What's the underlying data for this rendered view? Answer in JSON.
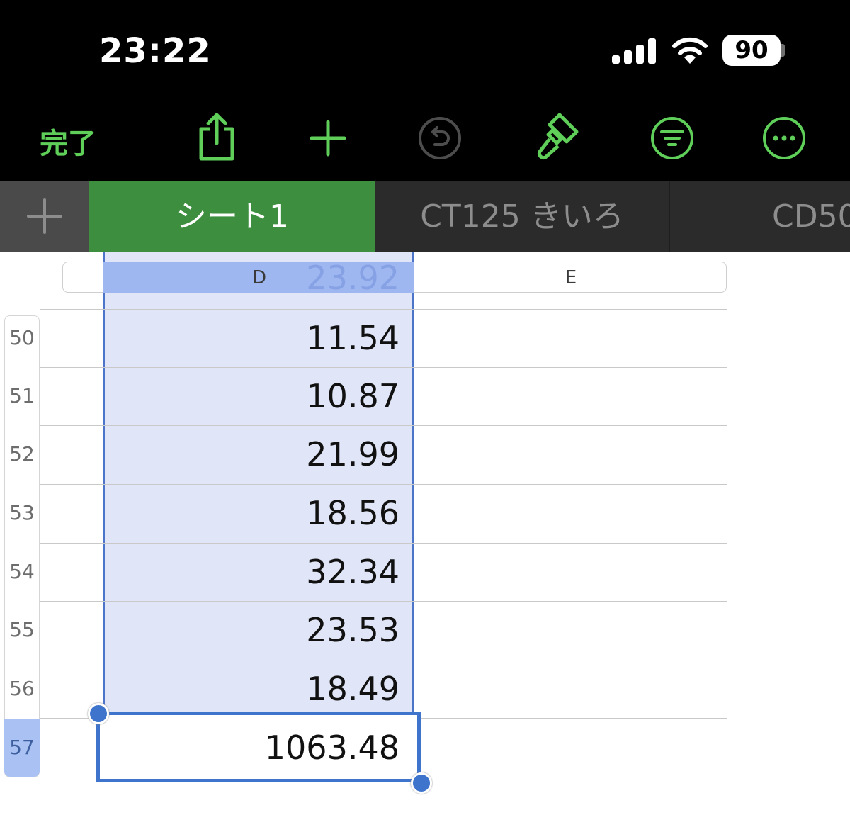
{
  "status_bar": {
    "time": "23:22",
    "battery": "90",
    "icons": [
      "cellular-signal-icon",
      "wifi-icon",
      "battery-icon"
    ]
  },
  "toolbar": {
    "done_label": "完了",
    "accent_color": "#5fcf5a",
    "icons": [
      "share-icon",
      "add-icon",
      "undo-icon",
      "paintbrush-icon",
      "filter-icon",
      "more-icon"
    ]
  },
  "tabs": {
    "add_label": "+",
    "items": [
      {
        "label": "シート1",
        "selected": true
      },
      {
        "label": "CT125 きいろ",
        "selected": false
      },
      {
        "label": "CD50",
        "selected": false
      }
    ]
  },
  "sheet": {
    "columns": [
      "D",
      "E"
    ],
    "partial_value_above": "23.92",
    "rows": [
      {
        "row": "50",
        "d": "11.54"
      },
      {
        "row": "51",
        "d": "10.87"
      },
      {
        "row": "52",
        "d": "21.99"
      },
      {
        "row": "53",
        "d": "18.56"
      },
      {
        "row": "54",
        "d": "32.34"
      },
      {
        "row": "55",
        "d": "23.53"
      },
      {
        "row": "56",
        "d": "18.49"
      },
      {
        "row": "57",
        "d": "1063.48",
        "active": true
      }
    ],
    "selection_color": "#3f74cc"
  }
}
